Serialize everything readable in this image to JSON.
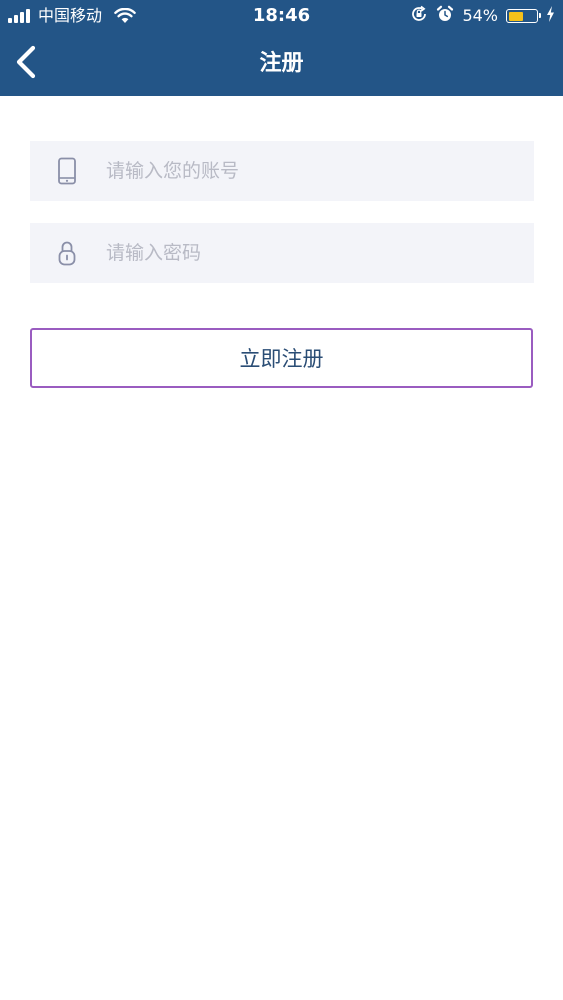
{
  "status_bar": {
    "carrier": "中国移动",
    "time": "18:46",
    "battery_percent": "54%",
    "battery_level": 0.54,
    "icons": [
      "signal-icon",
      "wifi-icon",
      "rotation-lock-icon",
      "alarm-icon",
      "battery-icon",
      "charging-icon"
    ]
  },
  "nav": {
    "title": "注册",
    "back_icon": "chevron-left-icon"
  },
  "form": {
    "account": {
      "placeholder": "请输入您的账号",
      "value": "",
      "icon": "phone-icon"
    },
    "password": {
      "placeholder": "请输入密码",
      "value": "",
      "icon": "lock-icon"
    },
    "submit_label": "立即注册"
  },
  "colors": {
    "header_bg": "#235587",
    "input_bg": "#f3f4f9",
    "button_border": "#9a5cc0",
    "button_text": "#2a4d75",
    "battery_fill": "#f5c11a"
  }
}
